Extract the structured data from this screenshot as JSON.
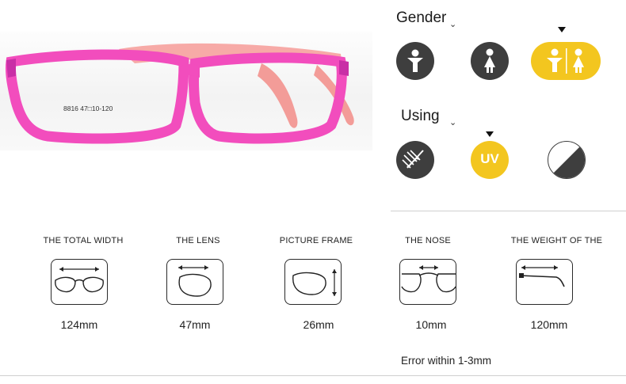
{
  "product": {
    "frame_print": "8816  47□10-120"
  },
  "gender": {
    "title": "Gender",
    "options": [
      "male-icon",
      "female-icon",
      "unisex-icon"
    ],
    "selected": "unisex-icon"
  },
  "using": {
    "title": "Using",
    "uv_label": "UV",
    "options": [
      "anti-glare-icon",
      "uv-icon",
      "tint-icon"
    ],
    "selected": "uv-icon"
  },
  "measurements": [
    {
      "label": "THE TOTAL WIDTH",
      "value": "124mm"
    },
    {
      "label": "THE LENS",
      "value": "47mm"
    },
    {
      "label": "PICTURE FRAME",
      "value": "26mm"
    },
    {
      "label": "THE NOSE",
      "value": "10mm"
    },
    {
      "label": "THE WEIGHT OF THE",
      "value": "120mm"
    }
  ],
  "note": "Error within 1-3mm",
  "colors": {
    "frame_front": "#f24dbd",
    "temple": "#f7a9a6",
    "icon_dark": "#3e3e3e",
    "accent_yellow": "#f3c61f"
  }
}
